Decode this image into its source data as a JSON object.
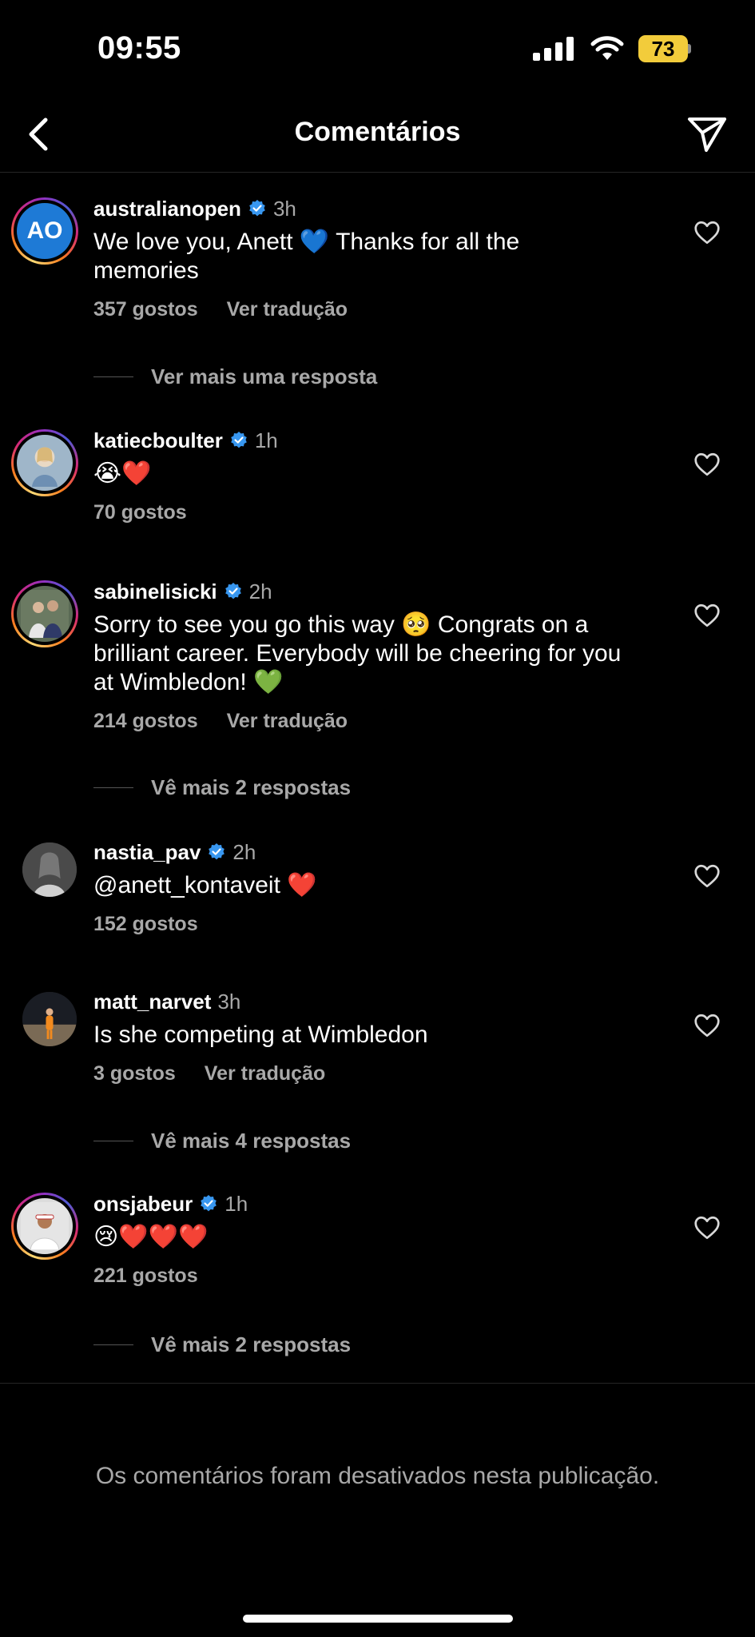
{
  "status_bar": {
    "time": "09:55",
    "battery": "73"
  },
  "header": {
    "title": "Comentários"
  },
  "comments": [
    {
      "username": "australianopen",
      "time": "3h",
      "text": "We love you, Anett 💙 Thanks for all the memories",
      "likes": "357 gostos",
      "translate": "Ver tradução",
      "replies": "Ver mais uma resposta"
    },
    {
      "username": "katiecboulter",
      "time": "1h",
      "text": "😭❤️",
      "likes": "70 gostos"
    },
    {
      "username": "sabinelisicki",
      "time": "2h",
      "text": "Sorry to see you go this way 🥺 Congrats on a brilliant career. Everybody will be cheering for you at Wimbledon! 💚",
      "likes": "214 gostos",
      "translate": "Ver tradução",
      "replies": "Vê mais 2 respostas"
    },
    {
      "username": "nastia_pav",
      "time": "2h",
      "text": "@anett_kontaveit ❤️",
      "likes": "152 gostos"
    },
    {
      "username": "matt_narvet",
      "time": "3h",
      "text": "Is she competing at Wimbledon",
      "likes": "3 gostos",
      "translate": "Ver tradução",
      "replies": "Vê mais 4 respostas"
    },
    {
      "username": "onsjabeur",
      "time": "1h",
      "text": "😢❤️❤️❤️",
      "likes": "221 gostos",
      "replies": "Vê mais 2 respostas"
    }
  ],
  "avatar_text": {
    "australianopen": "AO"
  },
  "footer": {
    "disabled_note": "Os comentários foram desativados nesta publicação."
  },
  "colors": {
    "background": "#000000",
    "muted": "#a8a8a8",
    "verified": "#3897f0",
    "battery": "#f2cc3b"
  },
  "icons": [
    "back-icon",
    "send-icon",
    "verified-icon",
    "heart-outline-icon",
    "signal-icon",
    "wifi-icon",
    "battery-icon"
  ]
}
